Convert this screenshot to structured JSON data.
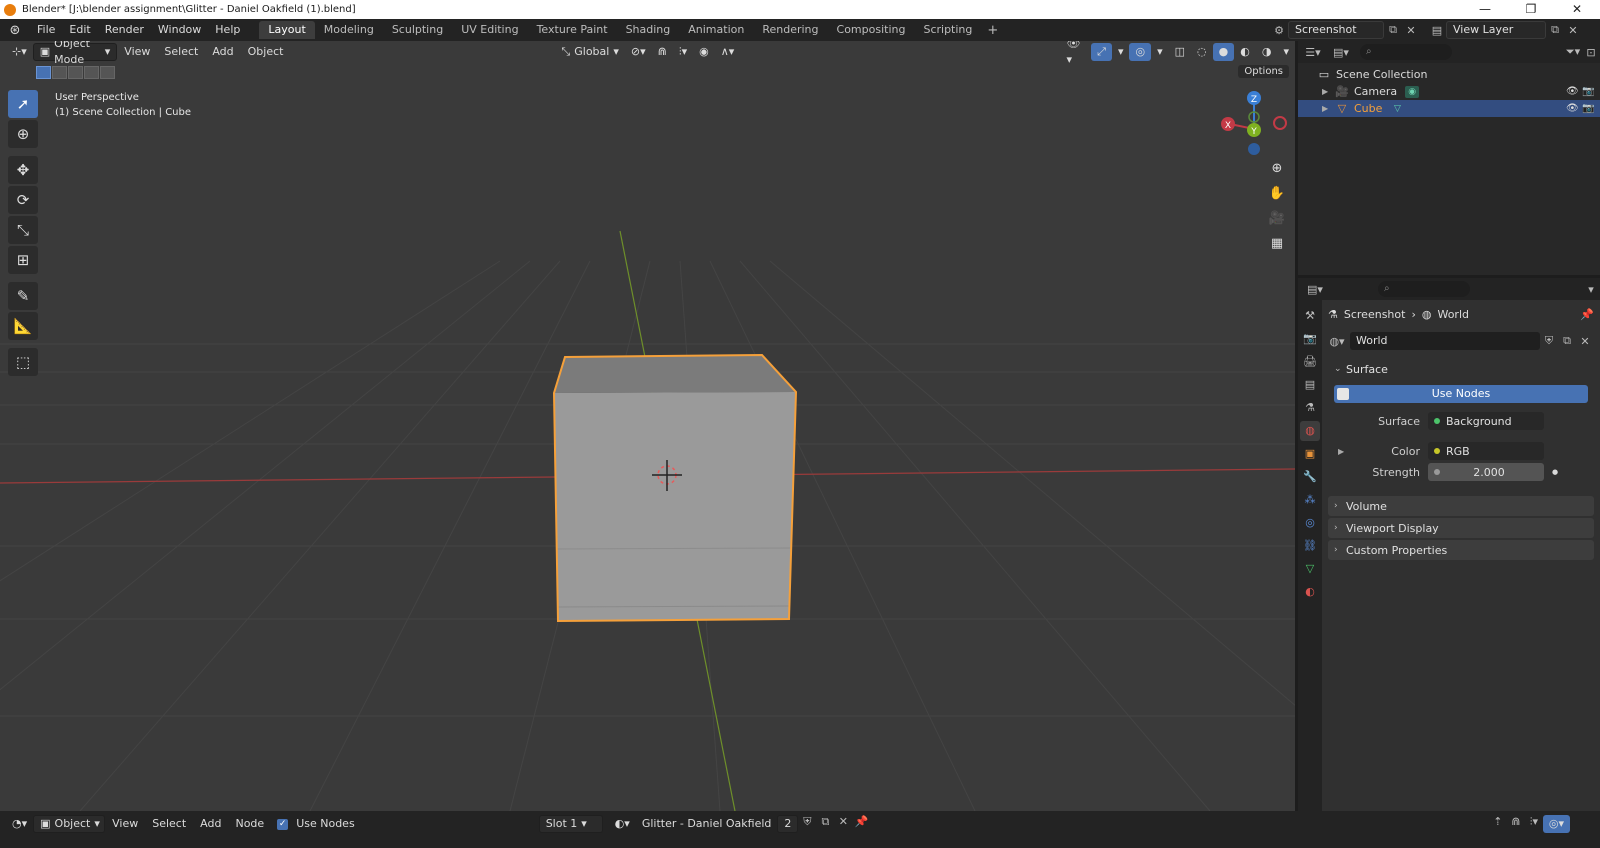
{
  "window": {
    "title": "Blender* [J:\\blender assignment\\Glitter - Daniel Oakfield (1).blend]",
    "controls": [
      "—",
      "❐",
      "✕"
    ]
  },
  "topbar": {
    "menus": [
      "File",
      "Edit",
      "Render",
      "Window",
      "Help"
    ],
    "workspaces": [
      "Layout",
      "Modeling",
      "Sculpting",
      "UV Editing",
      "Texture Paint",
      "Shading",
      "Animation",
      "Rendering",
      "Compositing",
      "Scripting"
    ],
    "active_workspace": "Layout",
    "add_tab": "+",
    "scene": "Screenshot",
    "view_layer": "View Layer"
  },
  "viewport": {
    "mode": "Object Mode",
    "menus": [
      "View",
      "Select",
      "Add",
      "Object"
    ],
    "orientation": "Global",
    "info_line1": "User Perspective",
    "info_line2": "(1) Scene Collection | Cube",
    "options": "Options",
    "gizmo": {
      "z": "Z",
      "x": "X",
      "y": "Y"
    }
  },
  "outliner": {
    "root": "Scene Collection",
    "items": [
      {
        "name": "Camera",
        "selected": false
      },
      {
        "name": "Cube",
        "selected": true
      }
    ]
  },
  "properties": {
    "breadcrumb": [
      "Screenshot",
      "World"
    ],
    "world_name": "World",
    "surface_panel": "Surface",
    "use_nodes": "Use Nodes",
    "surface_label": "Surface",
    "surface_value": "Background",
    "color_label": "Color",
    "color_value": "RGB",
    "strength_label": "Strength",
    "strength_value": "2.000",
    "collapsed_panels": [
      "Volume",
      "Viewport Display",
      "Custom Properties"
    ]
  },
  "bottombar": {
    "editor_mode": "Object",
    "menus": [
      "View",
      "Select",
      "Add",
      "Node"
    ],
    "use_nodes": "Use Nodes",
    "slot": "Slot 1",
    "material": "Glitter - Daniel Oakfield",
    "users": "2"
  },
  "colors": {
    "selection_outline": "#f5a03a",
    "active_blue": "#4772b3",
    "x_axis": "#c33a46",
    "y_axis": "#7fb120",
    "z_axis": "#3a7fd6"
  }
}
